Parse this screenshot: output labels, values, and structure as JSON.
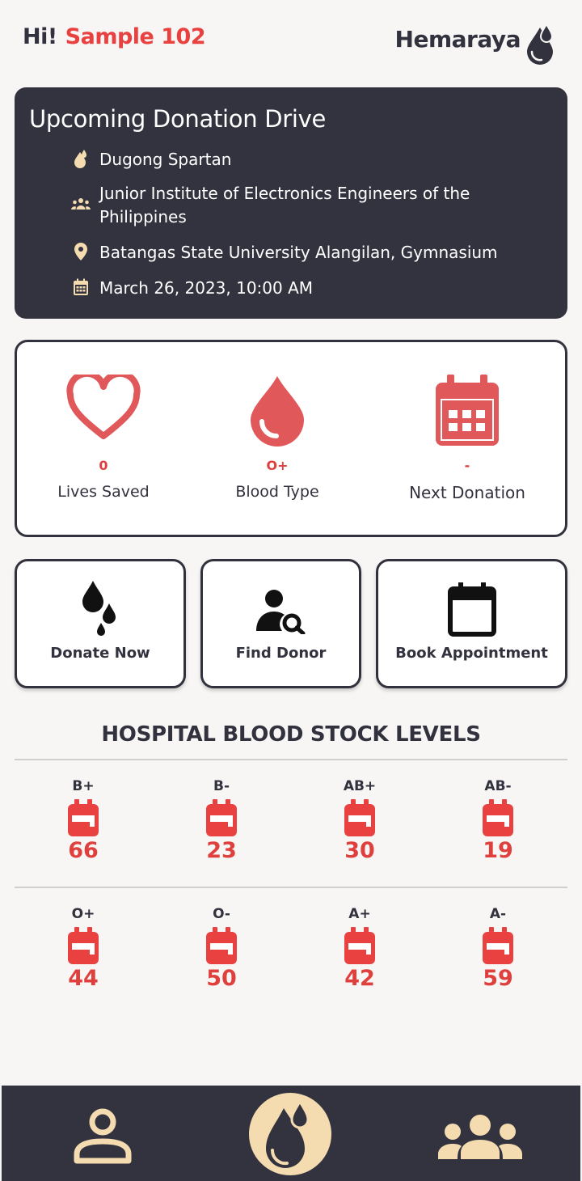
{
  "header": {
    "greeting": "Hi!",
    "user_name": "Sample 102",
    "brand": "Hemaraya"
  },
  "drive": {
    "title": "Upcoming Donation Drive",
    "organizer": "Dugong Spartan",
    "group": "Junior Institute of Electronics Engineers of the Philippines",
    "location": "Batangas State University Alangilan, Gymnasium",
    "datetime": "March 26, 2023, 10:00 AM"
  },
  "stats": [
    {
      "value": "0",
      "label": "Lives Saved",
      "icon": "heart-icon"
    },
    {
      "value": "O+",
      "label": "Blood Type",
      "icon": "blood-drop-icon"
    },
    {
      "value": "-",
      "label": "Next Donation",
      "icon": "calendar-icon"
    }
  ],
  "actions": [
    {
      "label": "Donate Now",
      "icon": "blood-drops-icon"
    },
    {
      "label": "Find Donor",
      "icon": "user-search-icon"
    },
    {
      "label": "Book Appointment",
      "icon": "calendar-icon"
    }
  ],
  "stock": {
    "title": "HOSPITAL BLOOD STOCK LEVELS",
    "items": [
      {
        "type": "B+",
        "count": "66"
      },
      {
        "type": "B-",
        "count": "23"
      },
      {
        "type": "AB+",
        "count": "30"
      },
      {
        "type": "AB-",
        "count": "19"
      },
      {
        "type": "O+",
        "count": "44"
      },
      {
        "type": "O-",
        "count": "50"
      },
      {
        "type": "A+",
        "count": "42"
      },
      {
        "type": "A-",
        "count": "59"
      }
    ]
  },
  "nav": [
    "profile-icon",
    "home-drop-icon",
    "community-icon"
  ],
  "colors": {
    "accent_red": "#e0403d",
    "dark": "#33333f",
    "cream": "#f5dcb0",
    "background": "#f7f6f4"
  }
}
